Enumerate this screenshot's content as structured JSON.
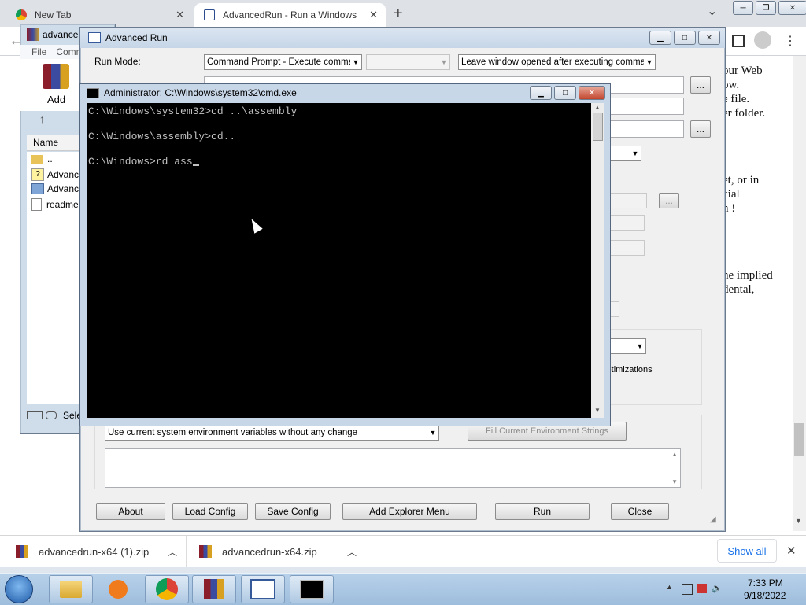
{
  "browser": {
    "tabs": [
      {
        "label": "New Tab",
        "active": false
      },
      {
        "label": "AdvancedRun - Run a Windows",
        "active": true
      }
    ],
    "new_tab_symbol": "+",
    "tab_search_symbol": "⌄",
    "page_text_lines": [
      "our Web",
      "ow.",
      "e file.",
      "er folder.",
      "et, or in",
      "cial",
      "n !",
      "he implied",
      "dental,"
    ]
  },
  "winrar": {
    "title": "advance",
    "menu": [
      "File",
      "Comm"
    ],
    "add_label": "Add",
    "column_header": "Name",
    "files": [
      "..",
      "Advance",
      "Advance",
      "readme."
    ],
    "status": "Sele"
  },
  "advancedrun": {
    "title": "Advanced Run",
    "run_mode_label": "Run Mode:",
    "run_mode_value": "Command Prompt - Execute command",
    "window_option_value": "Leave window opened after executing command",
    "browse_label": "...",
    "optimizations_text": "een optimizations",
    "env_option_value": "Use current system environment variables without any change",
    "fill_env_button": "Fill Current Environment Strings",
    "buttons": {
      "about": "About",
      "load_config": "Load Config",
      "save_config": "Save Config",
      "add_explorer_menu": "Add Explorer Menu",
      "run": "Run",
      "close": "Close"
    }
  },
  "cmd": {
    "title": "Administrator: C:\\Windows\\system32\\cmd.exe",
    "lines": [
      "C:\\Windows\\system32>cd ..\\assembly",
      "",
      "C:\\Windows\\assembly>cd..",
      "",
      "C:\\Windows>rd ass"
    ]
  },
  "downloads": {
    "items": [
      "advancedrun-x64 (1).zip",
      "advancedrun-x64.zip"
    ],
    "show_all": "Show all"
  },
  "taskbar": {
    "time": "7:33 PM",
    "date": "9/18/2022"
  }
}
